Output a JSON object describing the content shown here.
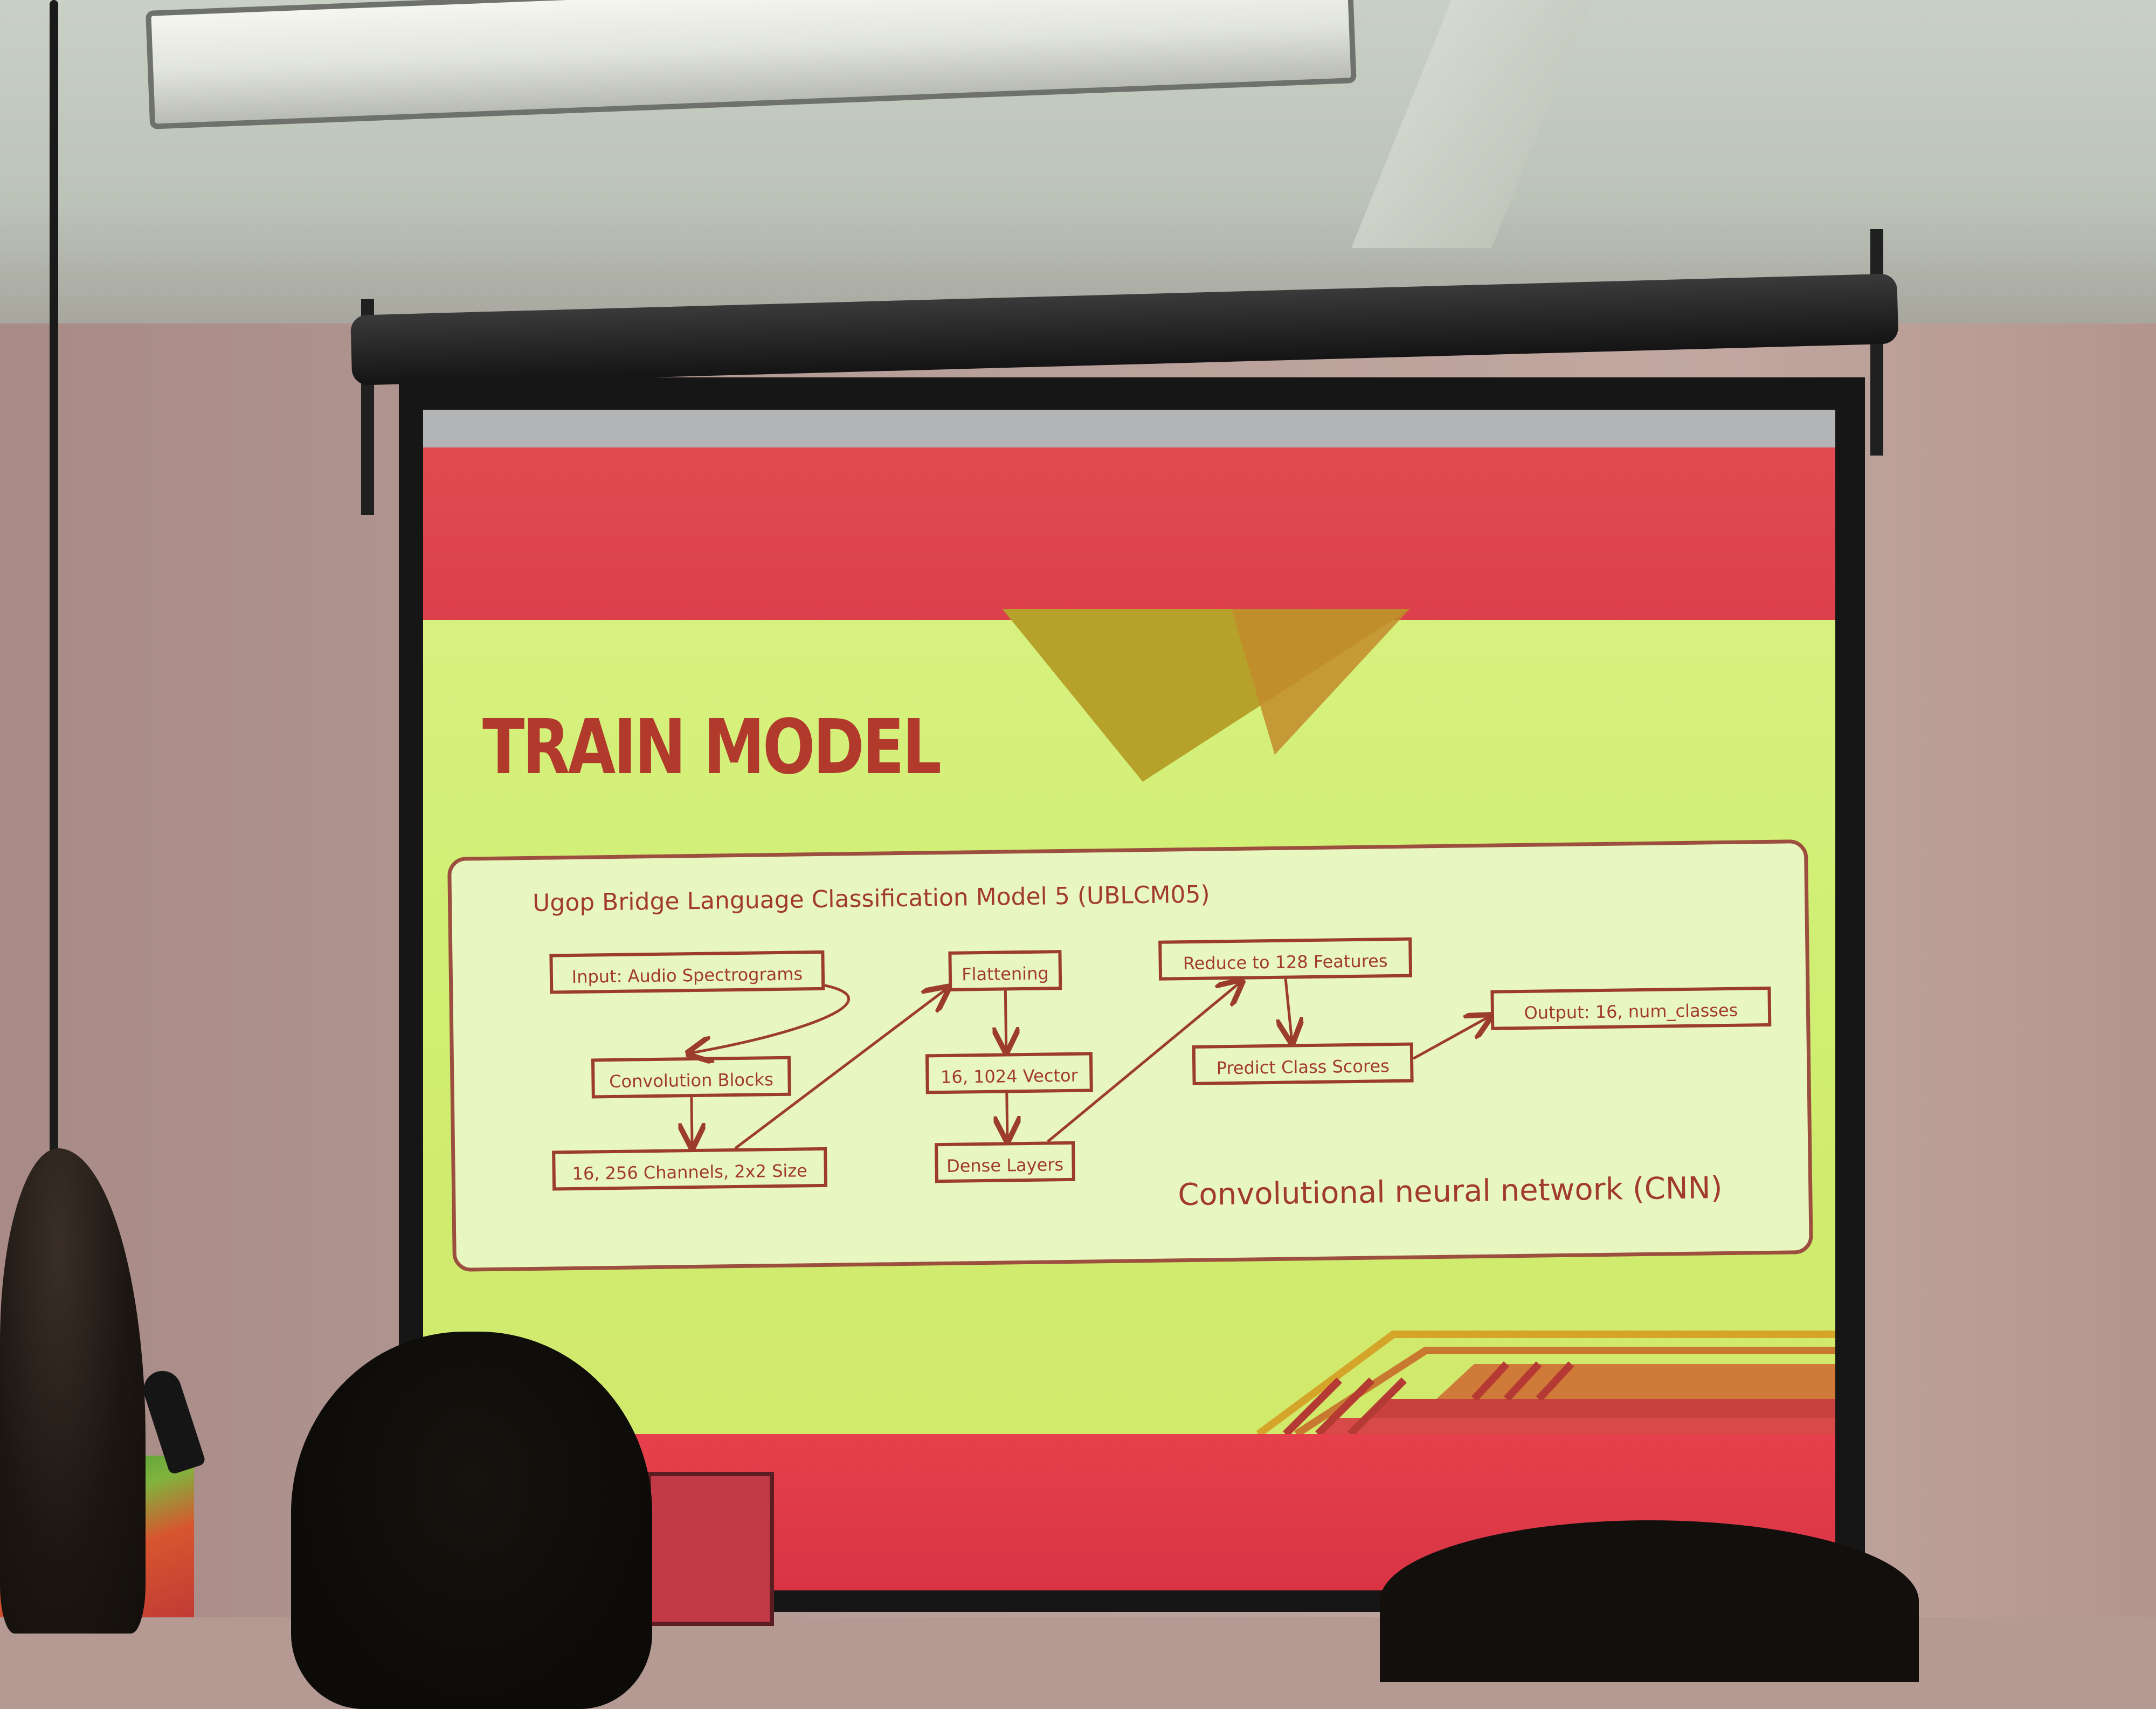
{
  "slide": {
    "title": "TRAIN MODEL",
    "diagram": {
      "title": "Ugop Bridge Language Classification Model 5 (UBLCM05)",
      "caption": "Convolutional neural network (CNN)",
      "nodes": {
        "input": "Input: Audio Spectrograms",
        "conv": "Convolution Blocks",
        "channels": "16, 256 Channels, 2x2 Size",
        "flatten": "Flattening",
        "vector": "16, 1024 Vector",
        "dense": "Dense Layers",
        "reduce": "Reduce to 128 Features",
        "predict": "Predict Class Scores",
        "output": "Output: 16, num_classes"
      }
    }
  },
  "colors": {
    "slide_red": "#e24b52",
    "slide_green": "#d4ef76",
    "triangle_olive": "#b6a12b",
    "accent_orange": "#d07a3a",
    "diagram_ink": "#a13b2c",
    "title_text": "#b23a2c"
  }
}
